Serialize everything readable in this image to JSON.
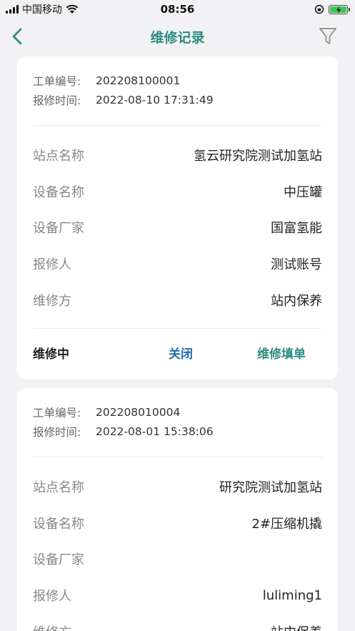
{
  "status_bar": {
    "carrier": "中国移动",
    "time": "08:56"
  },
  "header": {
    "title": "维修记录"
  },
  "colors": {
    "accent": "#2e8c82",
    "link": "#1f6fb0",
    "battery": "#3cc45a"
  },
  "labels": {
    "order_no": "工单编号:",
    "report_time": "报修时间:",
    "station": "站点名称",
    "device": "设备名称",
    "maker": "设备厂家",
    "reporter": "报修人",
    "repair_party": "维修方"
  },
  "orders": [
    {
      "order_no": "202208100001",
      "report_time": "2022-08-10 17:31:49",
      "station": "氢云研究院测试加氢站",
      "device": "中压罐",
      "maker": "国富氢能",
      "reporter": "测试账号",
      "repair_party": "站内保养",
      "status": "维修中",
      "close_label": "关闭",
      "fill_label": "维修填单"
    },
    {
      "order_no": "202208010004",
      "report_time": "2022-08-01 15:38:06",
      "station": "研究院测试加氢站",
      "device": "2#压缩机撬",
      "maker": "",
      "reporter": "luliming1",
      "repair_party": "站内保养"
    }
  ]
}
